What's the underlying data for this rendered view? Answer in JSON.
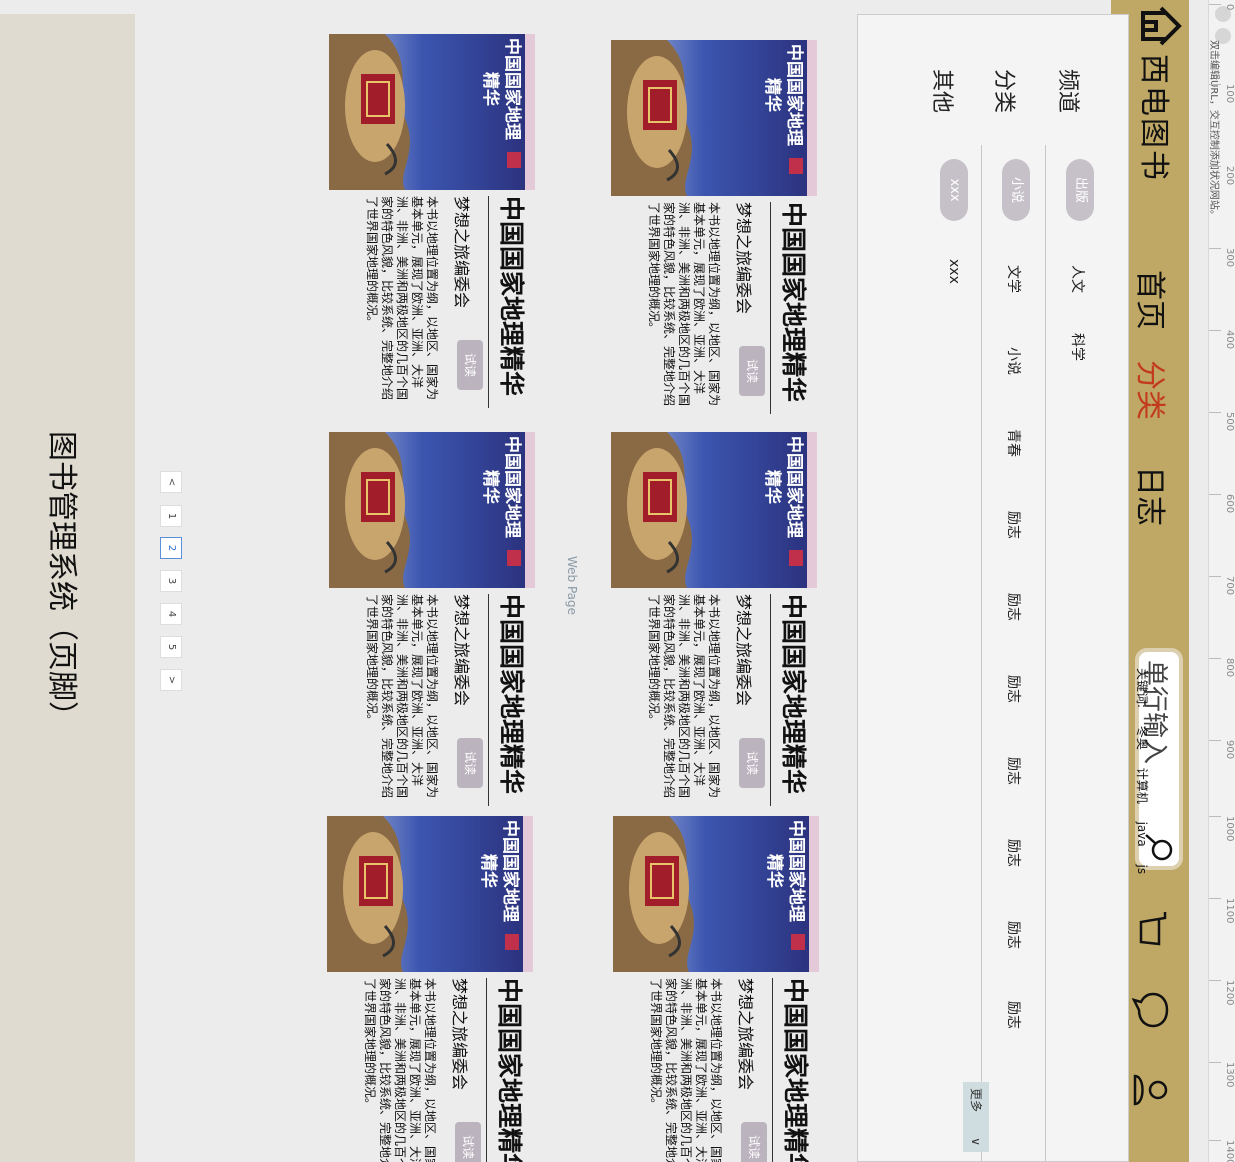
{
  "ruler": {
    "ticks": [
      "0",
      "100",
      "200",
      "300",
      "400",
      "500",
      "600",
      "700",
      "800",
      "900",
      "1000",
      "1100",
      "1200",
      "1300",
      "1400"
    ],
    "hint": "双击编辑URL，交互控制添加状况网站。"
  },
  "header": {
    "brand": "西电图书",
    "nav": [
      "首页",
      "分类",
      "日志"
    ],
    "active_nav": "分类",
    "search_placeholder": "单行输入",
    "keywords_label": "关键词:",
    "keywords": [
      "冬奥",
      "计算机",
      "java",
      "js"
    ],
    "accent_color": "#bfa865",
    "active_color": "#c23b1f"
  },
  "categories": {
    "rows": [
      {
        "label": "频道",
        "items": [
          "出版",
          "人文",
          "科学"
        ]
      },
      {
        "label": "分类",
        "items": [
          "小说",
          "文学",
          "小说",
          "青春",
          "励志",
          "励志",
          "励志",
          "励志",
          "励志",
          "励志",
          "励志"
        ]
      },
      {
        "label": "其他",
        "items": [
          "xxx",
          "xxx"
        ]
      }
    ],
    "more": "更多"
  },
  "books": [
    {
      "title": "中国国家地理精华",
      "author": "梦想之旅编委会",
      "button": "试读",
      "desc": "本书以地理位置为纲，以地区、国家为基本单元，展现了欧洲、亚洲、大洋洲、非洲、美洲和两极地区的几百个国家的特色风貌，比较系统、完整地介绍了世界国家地理的概况。",
      "cover_title": "中国国家地理",
      "cover_sub": "精华"
    },
    {
      "title": "中国国家地理精华",
      "author": "梦想之旅编委会",
      "button": "试读",
      "desc": "本书以地理位置为纲，以地区、国家为基本单元，展现了欧洲、亚洲、大洋洲、非洲、美洲和两极地区的几百个国家的特色风貌，比较系统、完整地介绍了世界国家地理的概况。",
      "cover_title": "中国国家地理",
      "cover_sub": "精华"
    },
    {
      "title": "中国国家地理精华",
      "author": "梦想之旅编委会",
      "button": "试读",
      "desc": "本书以地理位置为纲，以地区、国家为基本单元，展现了欧洲、亚洲、大洋洲、非洲、美洲和两极地区的几百个国家的特色风貌，比较系统、完整地介绍了世界国家地理的概况。",
      "cover_title": "中国国家地理",
      "cover_sub": "精华"
    },
    {
      "title": "中国国家地理精华",
      "author": "梦想之旅编委会",
      "button": "试读",
      "desc": "本书以地理位置为纲，以地区、国家为基本单元，展现了欧洲、亚洲、大洋洲、非洲、美洲和两极地区的几百个国家的特色风貌，比较系统、完整地介绍了世界国家地理的概况。",
      "cover_title": "中国国家地理",
      "cover_sub": "精华"
    },
    {
      "title": "中国国家地理精华",
      "author": "梦想之旅编委会",
      "button": "试读",
      "desc": "本书以地理位置为纲，以地区、国家为基本单元，展现了欧洲、亚洲、大洋洲、非洲、美洲和两极地区的几百个国家的特色风貌，比较系统、完整地介绍了世界国家地理的概况。",
      "cover_title": "中国国家地理",
      "cover_sub": "精华"
    },
    {
      "title": "中国国家地理精华",
      "author": "梦想之旅编委会",
      "button": "试读",
      "desc": "本书以地理位置为纲，以地区、国家为基本单元，展现了欧洲、亚洲、大洋洲、非洲、美洲和两极地区的几百个国家的特色风貌，比较系统、完整地介绍了世界国家地理的概况。",
      "cover_title": "中国国家地理",
      "cover_sub": "精华"
    }
  ],
  "web_page_label": "Web Page",
  "pagination": {
    "prev": "<",
    "pages": [
      "1",
      "2",
      "3",
      "4",
      "5"
    ],
    "current": "2",
    "next": ">"
  },
  "footer": {
    "text": "图书管理系统（页脚）"
  }
}
